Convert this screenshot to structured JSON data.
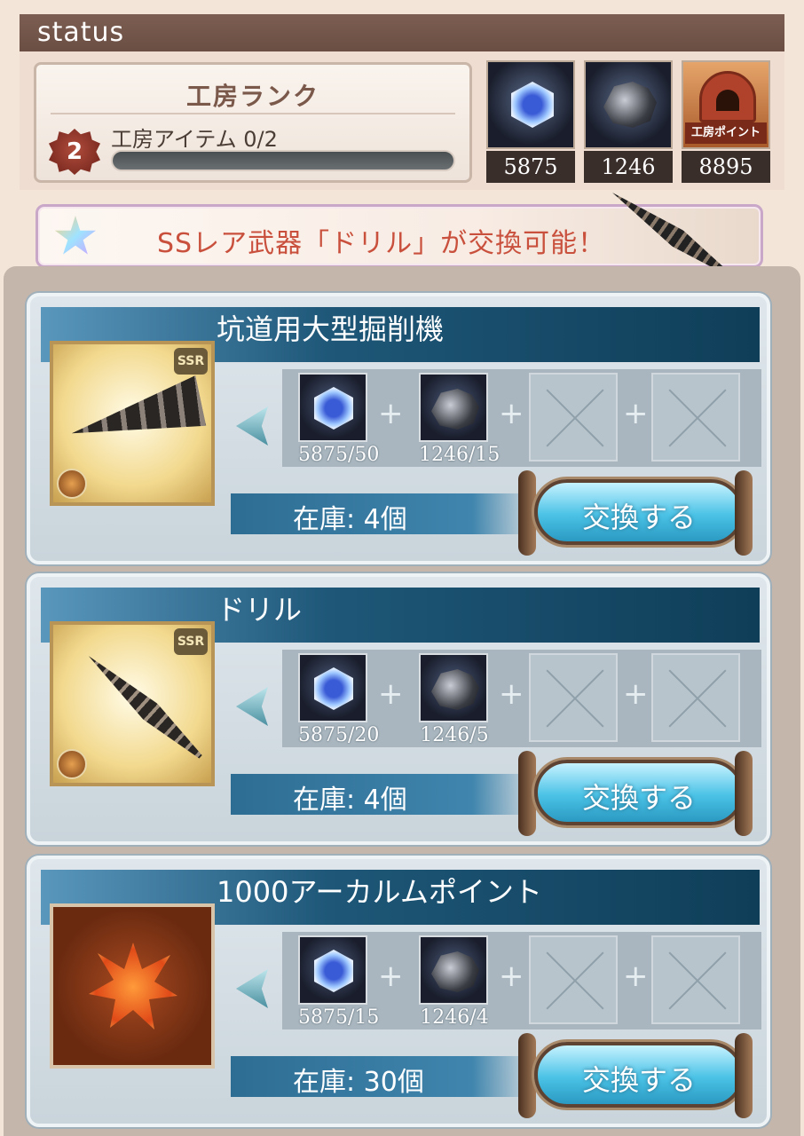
{
  "status": {
    "header": "status",
    "rank_title": "工房ランク",
    "rank_level": "2",
    "rank_item_label": "工房アイテム 0/2",
    "rank_progress": 0,
    "resources": [
      {
        "icon": "blue-crystal-icon",
        "count": "5875"
      },
      {
        "icon": "dark-ore-icon",
        "count": "1246"
      },
      {
        "icon": "workshop-point-icon",
        "label": "工房ポイント",
        "count": "8895"
      }
    ]
  },
  "banner": {
    "icon": "rainbow-star-icon",
    "text": "SSレア武器「ドリル」が交換可能！"
  },
  "cards": [
    {
      "title": "坑道用大型掘削機",
      "icon": "large-drill-weapon-icon",
      "rarity": "SSR",
      "materials": [
        {
          "icon": "blue-crystal-icon",
          "count": "5875/50"
        },
        {
          "icon": "dark-ore-icon",
          "count": "1246/15"
        }
      ],
      "stock": "在庫: 4個",
      "button": "交換する"
    },
    {
      "title": "ドリル",
      "icon": "drill-spear-icon",
      "rarity": "SSR",
      "materials": [
        {
          "icon": "blue-crystal-icon",
          "count": "5875/20"
        },
        {
          "icon": "dark-ore-icon",
          "count": "1246/5"
        }
      ],
      "stock": "在庫: 4個",
      "button": "交換する"
    },
    {
      "title": "1000アーカルムポイント",
      "icon": "arcarum-point-icon",
      "rarity": "",
      "materials": [
        {
          "icon": "blue-crystal-icon",
          "count": "5875/15"
        },
        {
          "icon": "dark-ore-icon",
          "count": "1246/4"
        }
      ],
      "stock": "在庫: 30個",
      "button": "交換する"
    }
  ]
}
